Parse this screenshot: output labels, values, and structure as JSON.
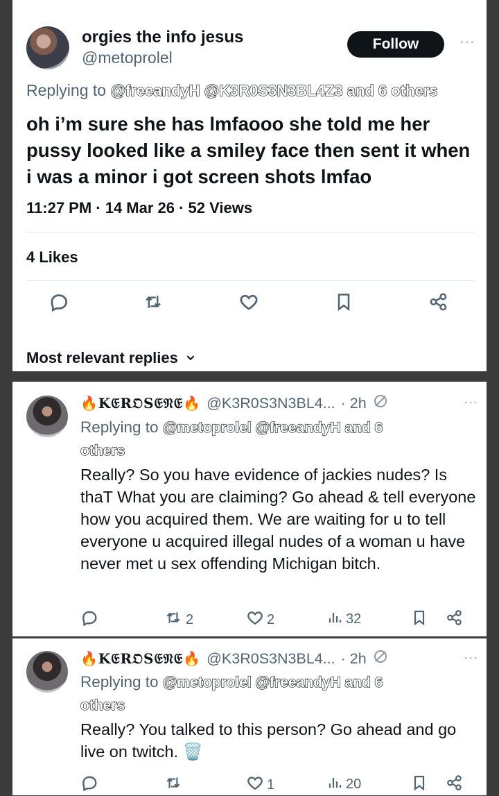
{
  "main": {
    "display_name": "orgies the info jesus",
    "handle": "@metoprolel",
    "follow_label": "Follow",
    "replying_prefix": "Replying to",
    "replying_to": "@freeandyH @K3R0S3N3BL4Z3 and 6 others",
    "text": "oh i’m sure she has lmfaooo she told me her pussy looked like a smiley face then sent it when i was a minor i got screen shots lmfao",
    "meta": "11:27 PM · 14 Mar 26 · 52 Views",
    "likes": "4 Likes",
    "replies_header": "Most relevant replies"
  },
  "replies": [
    {
      "name": "🔥K𝔈R𝔒S𝔈𝔑𝔈🔥",
      "name_plain": "KƐRʘSƐɅƐ",
      "handle": "@K3R0S3N3BL4...",
      "time": "· 2h",
      "replying_prefix": "Replying to",
      "replying_to": "@metoprolel @freeandyH and 6 others",
      "text": "Really? So you have evidence of jackies nudes? Is thaT What you are claiming?  Go ahead & tell everyone how you acquired them. We are waiting for u to tell everyone u acquired illegal nudes of a woman u have never met u sex offending Michigan bitch.",
      "retweets": "2",
      "likes": "2",
      "views": "32"
    },
    {
      "name": "🔥K𝔈R𝔒S𝔈𝔑𝔈🔥",
      "name_plain": "KƐRʘSƐɅƐ",
      "handle": "@K3R0S3N3BL4...",
      "time": "· 2h",
      "replying_prefix": "Replying to",
      "replying_to": "@metoprolel @freeandyH and 6 others",
      "text": "Really? You talked to this person? Go ahead and go live on twitch. 🗑️",
      "retweets": "",
      "likes": "1",
      "views": "20"
    }
  ]
}
